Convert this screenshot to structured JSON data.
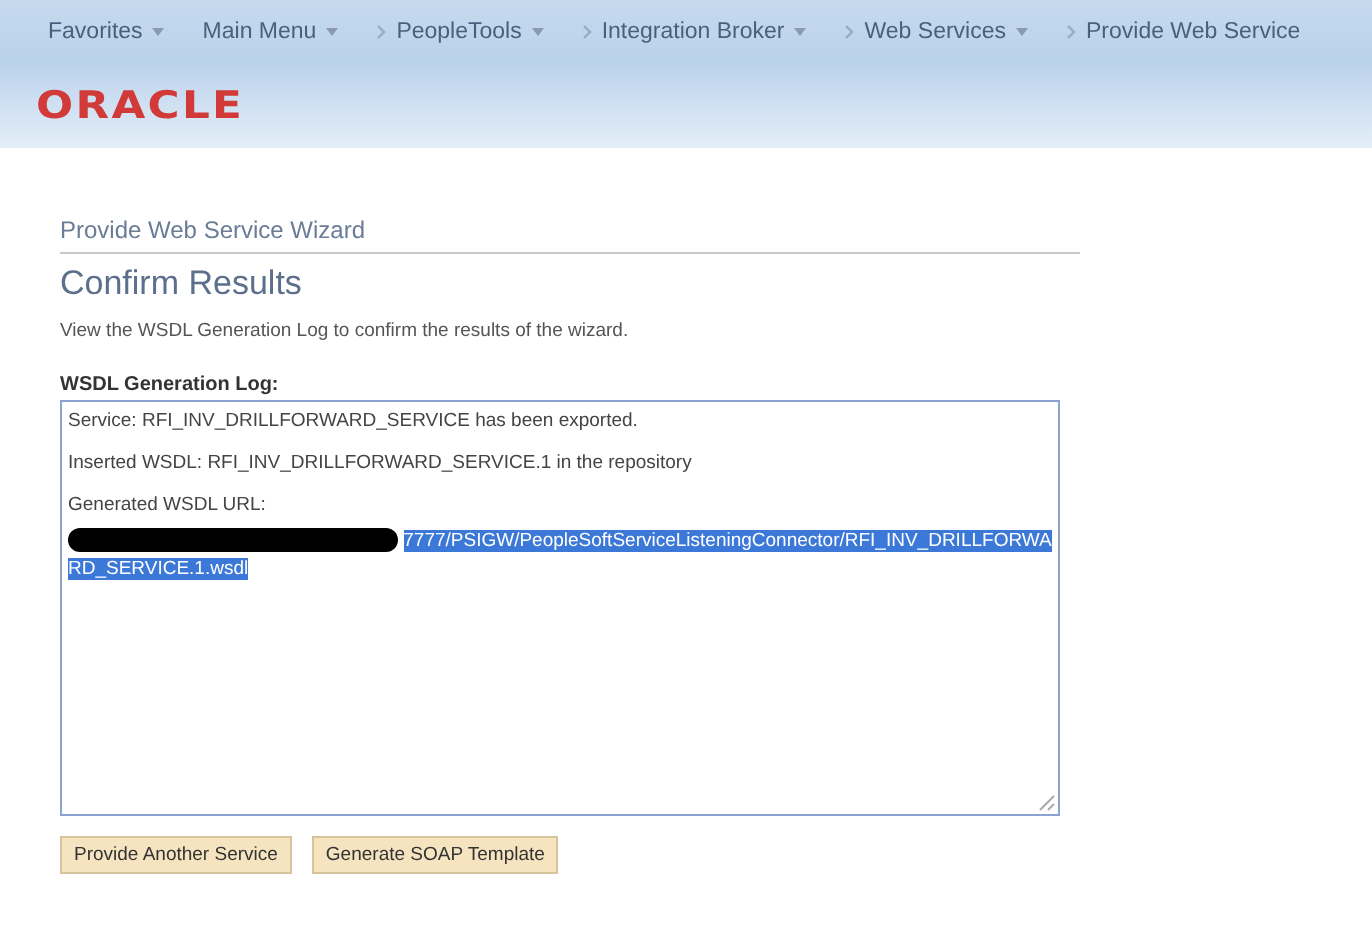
{
  "nav": [
    {
      "label": "Favorites",
      "kind": "menu"
    },
    {
      "label": "Main Menu",
      "kind": "menu"
    },
    {
      "label": "PeopleTools",
      "kind": "crumb"
    },
    {
      "label": "Integration Broker",
      "kind": "crumb"
    },
    {
      "label": "Web Services",
      "kind": "crumb"
    },
    {
      "label": "Provide Web Service",
      "kind": "last"
    }
  ],
  "logo": "ORACLE",
  "wizard_title": "Provide Web Service Wizard",
  "page_title": "Confirm Results",
  "instruction": "View the WSDL Generation Log to confirm the results of the wizard.",
  "log": {
    "label": "WSDL Generation Log:",
    "lines": [
      {
        "kind": "text",
        "text": "Service: RFI_INV_DRILLFORWARD_SERVICE has been exported."
      },
      {
        "kind": "text",
        "text": "Inserted WSDL: RFI_INV_DRILLFORWARD_SERVICE.1 in the repository"
      },
      {
        "kind": "text",
        "text": "Generated WSDL URL:"
      },
      {
        "kind": "url",
        "redacted": true,
        "selected": true,
        "text": "7777/PSIGW/PeopleSoftServiceListeningConnector/RFI_INV_DRILLFORWARD_SERVICE.1.wsdl"
      }
    ]
  },
  "buttons": [
    "Provide Another Service",
    "Generate SOAP Template"
  ]
}
